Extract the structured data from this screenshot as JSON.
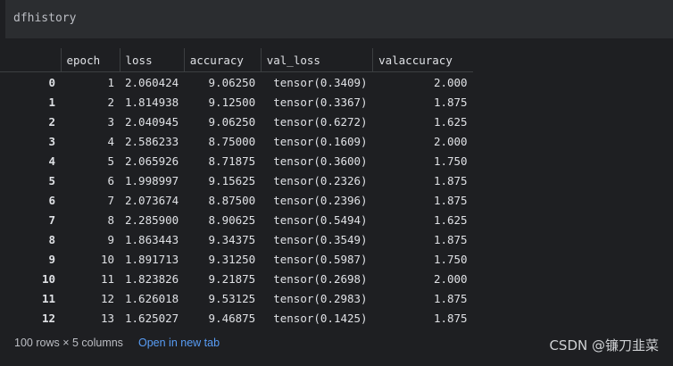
{
  "code_cell": {
    "text": "dfhistory"
  },
  "table": {
    "columns": [
      "epoch",
      "loss",
      "accuracy",
      "val_loss",
      "valaccuracy"
    ],
    "rows": [
      [
        "0",
        "1",
        "2.060424",
        "9.06250",
        "tensor(0.3409)",
        "2.000"
      ],
      [
        "1",
        "2",
        "1.814938",
        "9.12500",
        "tensor(0.3367)",
        "1.875"
      ],
      [
        "2",
        "3",
        "2.040945",
        "9.06250",
        "tensor(0.6272)",
        "1.625"
      ],
      [
        "3",
        "4",
        "2.586233",
        "8.75000",
        "tensor(0.1609)",
        "2.000"
      ],
      [
        "4",
        "5",
        "2.065926",
        "8.71875",
        "tensor(0.3600)",
        "1.750"
      ],
      [
        "5",
        "6",
        "1.998997",
        "9.15625",
        "tensor(0.2326)",
        "1.875"
      ],
      [
        "6",
        "7",
        "2.073674",
        "8.87500",
        "tensor(0.2396)",
        "1.875"
      ],
      [
        "7",
        "8",
        "2.285900",
        "8.90625",
        "tensor(0.5494)",
        "1.625"
      ],
      [
        "8",
        "9",
        "1.863443",
        "9.34375",
        "tensor(0.3549)",
        "1.875"
      ],
      [
        "9",
        "10",
        "1.891713",
        "9.31250",
        "tensor(0.5987)",
        "1.750"
      ],
      [
        "10",
        "11",
        "1.823826",
        "9.21875",
        "tensor(0.2698)",
        "2.000"
      ],
      [
        "11",
        "12",
        "1.626018",
        "9.53125",
        "tensor(0.2983)",
        "1.875"
      ],
      [
        "12",
        "13",
        "1.625027",
        "9.46875",
        "tensor(0.1425)",
        "1.875"
      ]
    ]
  },
  "footer": {
    "summary": "100 rows × 5 columns",
    "open_link": "Open in new tab",
    "watermark": "CSDN @镰刀韭菜"
  }
}
